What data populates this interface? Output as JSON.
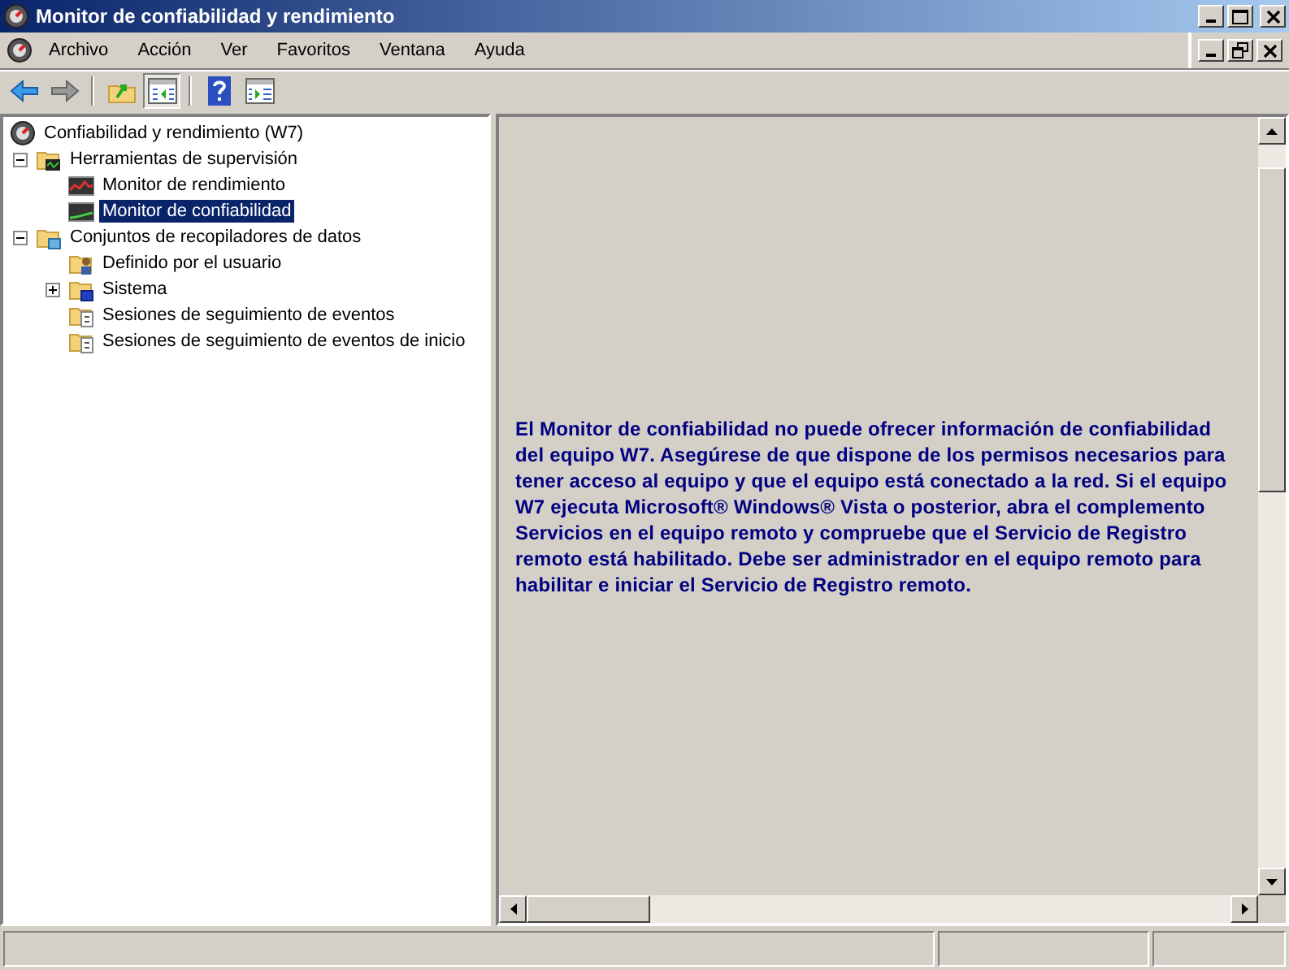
{
  "window": {
    "title": "Monitor de confiabilidad y rendimiento"
  },
  "menu": [
    "Archivo",
    "Acción",
    "Ver",
    "Favoritos",
    "Ventana",
    "Ayuda"
  ],
  "toolbar": [
    {
      "kind": "back",
      "selected": false
    },
    {
      "kind": "forward",
      "selected": false
    },
    {
      "kind": "up",
      "selected": false
    },
    {
      "kind": "tree",
      "selected": true
    },
    {
      "kind": "help",
      "selected": false
    },
    {
      "kind": "action",
      "selected": false
    }
  ],
  "tree": [
    {
      "label": "Confiabilidad y rendimiento (W7)",
      "kind": "computer",
      "selected": false,
      "children": [
        {
          "label": "Herramientas de supervisión",
          "kind": "folder-tools",
          "selected": false,
          "expanded": true,
          "children": [
            {
              "label": "Monitor de rendimiento",
              "kind": "chart-red",
              "selected": false
            },
            {
              "label": "Monitor de confiabilidad",
              "kind": "chart-green",
              "selected": true
            }
          ]
        },
        {
          "label": "Conjuntos de recopiladores de datos",
          "kind": "folder-data",
          "selected": false,
          "expanded": true,
          "children": [
            {
              "label": "Definido por el usuario",
              "kind": "folder-user",
              "selected": false
            },
            {
              "label": "Sistema",
              "kind": "folder-system",
              "selected": false,
              "expanded": false
            },
            {
              "label": "Sesiones de seguimiento de eventos",
              "kind": "folder-trace",
              "selected": false
            },
            {
              "label": "Sesiones de seguimiento de eventos de inicio",
              "kind": "folder-trace",
              "selected": false
            }
          ]
        }
      ]
    }
  ],
  "message": "El Monitor de confiabilidad no puede ofrecer información de confiabilidad del equipo W7. Asegúrese de que dispone de los permisos necesarios para tener acceso al equipo y que el equipo está conectado a la red. Si el equipo W7 ejecuta Microsoft® Windows® Vista o posterior, abra el complemento Servicios en el equipo remoto y compruebe que el Servicio de Registro remoto está habilitado. Debe ser administrador en el equipo remoto para habilitar e iniciar el Servicio de Registro remoto."
}
